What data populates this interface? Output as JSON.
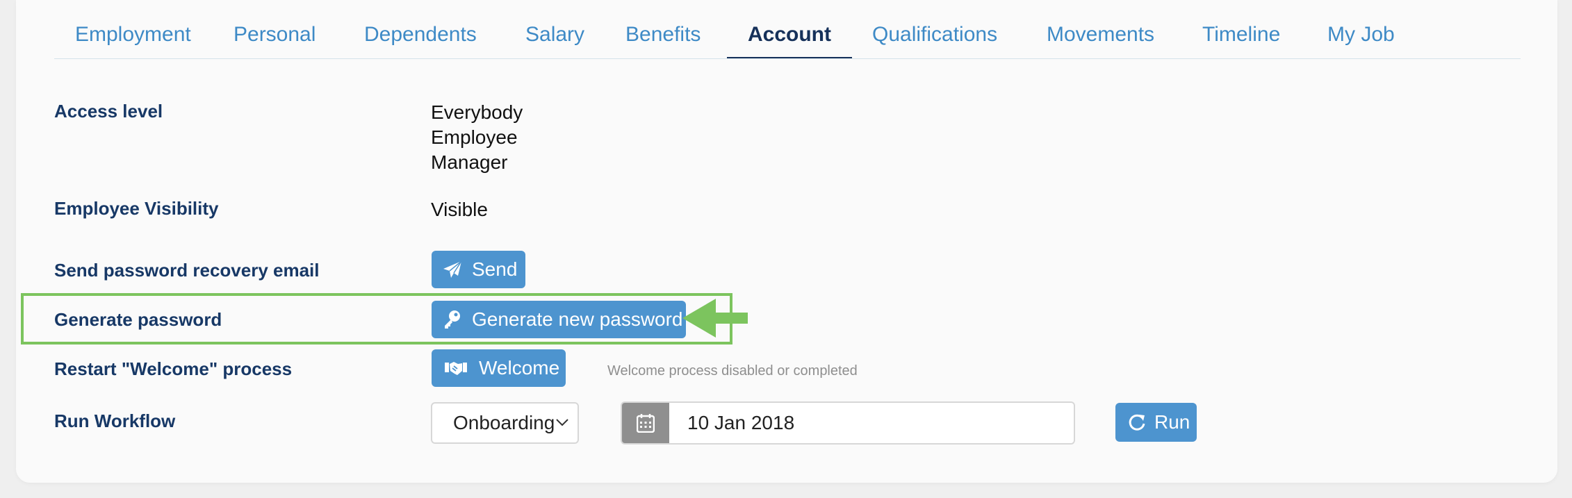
{
  "tabs": [
    {
      "label": "Employment"
    },
    {
      "label": "Personal"
    },
    {
      "label": "Dependents"
    },
    {
      "label": "Salary"
    },
    {
      "label": "Benefits"
    },
    {
      "label": "Account"
    },
    {
      "label": "Qualifications"
    },
    {
      "label": "Movements"
    },
    {
      "label": "Timeline"
    },
    {
      "label": "My Job"
    }
  ],
  "active_tab": "Account",
  "access_level": {
    "label": "Access level",
    "values": [
      "Everybody",
      "Employee",
      "Manager"
    ]
  },
  "visibility": {
    "label": "Employee Visibility",
    "value": "Visible"
  },
  "recovery": {
    "label": "Send password recovery email",
    "button": "Send"
  },
  "generate": {
    "label": "Generate password",
    "button": "Generate new password"
  },
  "welcome": {
    "label": "Restart \"Welcome\" process",
    "button": "Welcome",
    "status": "Welcome process disabled or completed"
  },
  "workflow": {
    "label": "Run Workflow",
    "select_value": "Onboarding",
    "date": "10 Jan 2018",
    "button": "Run"
  },
  "colors": {
    "accent": "#4d94cf",
    "heading": "#173866",
    "highlight": "#7cc45e"
  },
  "icons": {
    "send": "paper-plane-icon",
    "generate": "key-icon",
    "welcome": "handshake-icon",
    "calendar": "calendar-icon",
    "run": "refresh-icon",
    "select": "chevron-down-icon"
  }
}
